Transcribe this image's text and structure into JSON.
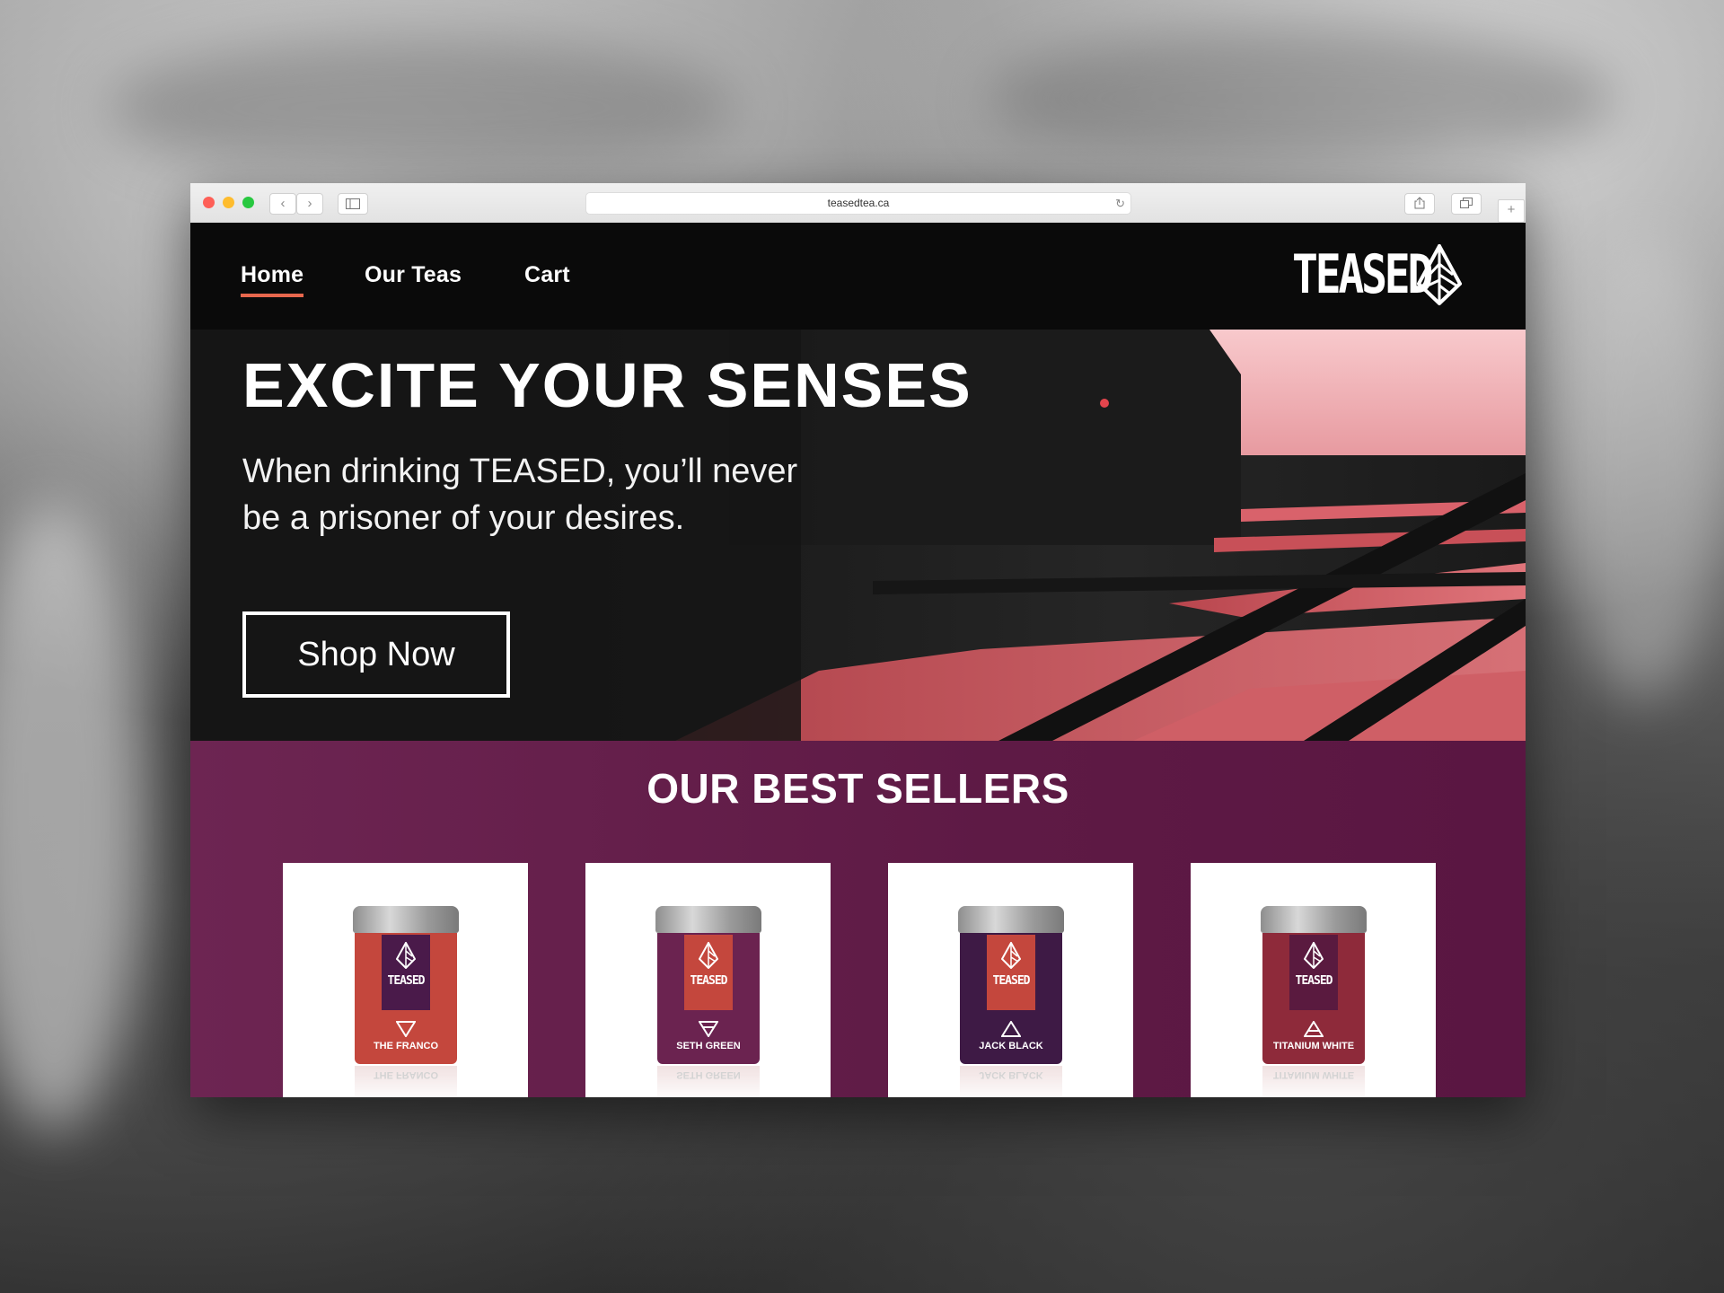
{
  "browser": {
    "url": "teasedtea.ca"
  },
  "nav": {
    "items": [
      {
        "label": "Home",
        "active": true
      },
      {
        "label": "Our Teas",
        "active": false
      },
      {
        "label": "Cart",
        "active": false
      }
    ]
  },
  "brand": {
    "logo_text": "TEASED",
    "logo_icon": "diamond-leaf-icon"
  },
  "hero": {
    "title": "EXCITE YOUR SENSES",
    "subtitle_line1": "When drinking TEASED, you’ll never",
    "subtitle_line2": "be a prisoner of your desires.",
    "cta_label": "Shop Now"
  },
  "best_sellers": {
    "title": "OUR BEST SELLERS",
    "products": [
      {
        "name": "THE FRANCO",
        "brand": "TEASED",
        "body_color": "#c4473d",
        "label_color": "#4a1a4a",
        "symbol": "triangle-down-icon"
      },
      {
        "name": "SETH GREEN",
        "brand": "TEASED",
        "body_color": "#6b2350",
        "label_color": "#c4473d",
        "symbol": "triangle-down-bar-icon"
      },
      {
        "name": "JACK BLACK",
        "brand": "TEASED",
        "body_color": "#3e1a45",
        "label_color": "#c4473d",
        "symbol": "triangle-up-icon"
      },
      {
        "name": "TITANIUM WHITE",
        "brand": "TEASED",
        "body_color": "#8e2a3a",
        "label_color": "#5a1a3f",
        "symbol": "triangle-up-bar-icon"
      }
    ]
  },
  "colors": {
    "accent": "#e8674d",
    "section_bg": "#5e1a45",
    "header_bg": "#0a0a0a"
  }
}
